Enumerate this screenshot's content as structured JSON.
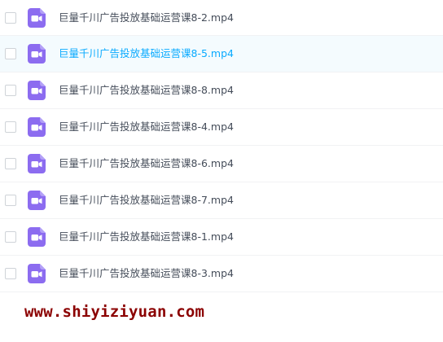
{
  "files": [
    {
      "name": "巨量千川广告投放基础运营课8-2.mp4",
      "icon": "video-file-icon"
    },
    {
      "name": "巨量千川广告投放基础运营课8-5.mp4",
      "icon": "video-file-icon"
    },
    {
      "name": "巨量千川广告投放基础运营课8-8.mp4",
      "icon": "video-file-icon"
    },
    {
      "name": "巨量千川广告投放基础运营课8-4.mp4",
      "icon": "video-file-icon"
    },
    {
      "name": "巨量千川广告投放基础运营课8-6.mp4",
      "icon": "video-file-icon"
    },
    {
      "name": "巨量千川广告投放基础运营课8-7.mp4",
      "icon": "video-file-icon"
    },
    {
      "name": "巨量千川广告投放基础运营课8-1.mp4",
      "icon": "video-file-icon"
    },
    {
      "name": "巨量千川广告投放基础运营课8-3.mp4",
      "icon": "video-file-icon"
    }
  ],
  "watermark": "www.shiyiziyuan.com",
  "colors": {
    "icon": "#8c6cf0",
    "text": "#454d5a",
    "hover_text": "#09aaff",
    "hover_row": "#f4fbfe",
    "watermark": "#8b0000"
  }
}
